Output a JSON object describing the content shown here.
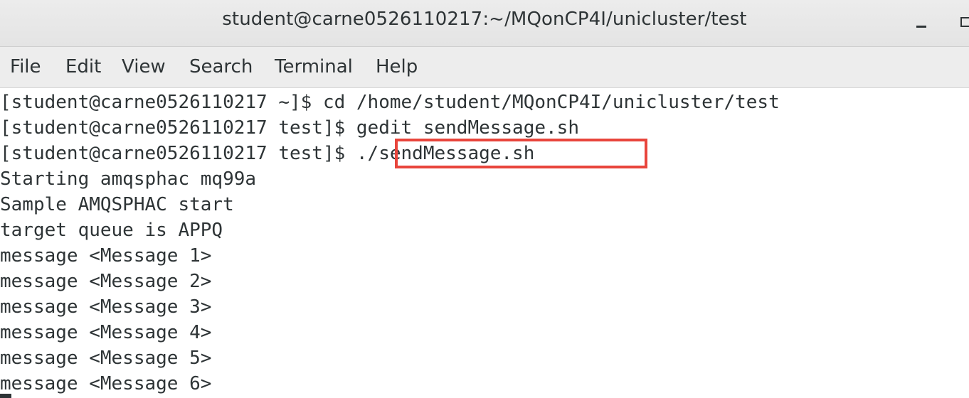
{
  "window": {
    "title": "student@carne0526110217:~/MQonCP4I/unicluster/test"
  },
  "menubar": {
    "items": [
      {
        "label": "File"
      },
      {
        "label": "Edit"
      },
      {
        "label": "View"
      },
      {
        "label": "Search"
      },
      {
        "label": "Terminal"
      },
      {
        "label": "Help"
      }
    ]
  },
  "terminal": {
    "lines": [
      "[student@carne0526110217 ~]$ cd /home/student/MQonCP4I/unicluster/test",
      "[student@carne0526110217 test]$ gedit sendMessage.sh",
      "[student@carne0526110217 test]$ ./sendMessage.sh",
      "Starting amqsphac mq99a",
      "Sample AMQSPHAC start",
      "target queue is APPQ",
      "message <Message 1>",
      "message <Message 2>",
      "message <Message 3>",
      "message <Message 4>",
      "message <Message 5>",
      "message <Message 6>"
    ],
    "highlighted_command": "./sendMessage.sh",
    "highlight_color": "#e8453c"
  },
  "icons": {
    "minimize": "minimize-icon",
    "maximize": "maximize-icon"
  }
}
